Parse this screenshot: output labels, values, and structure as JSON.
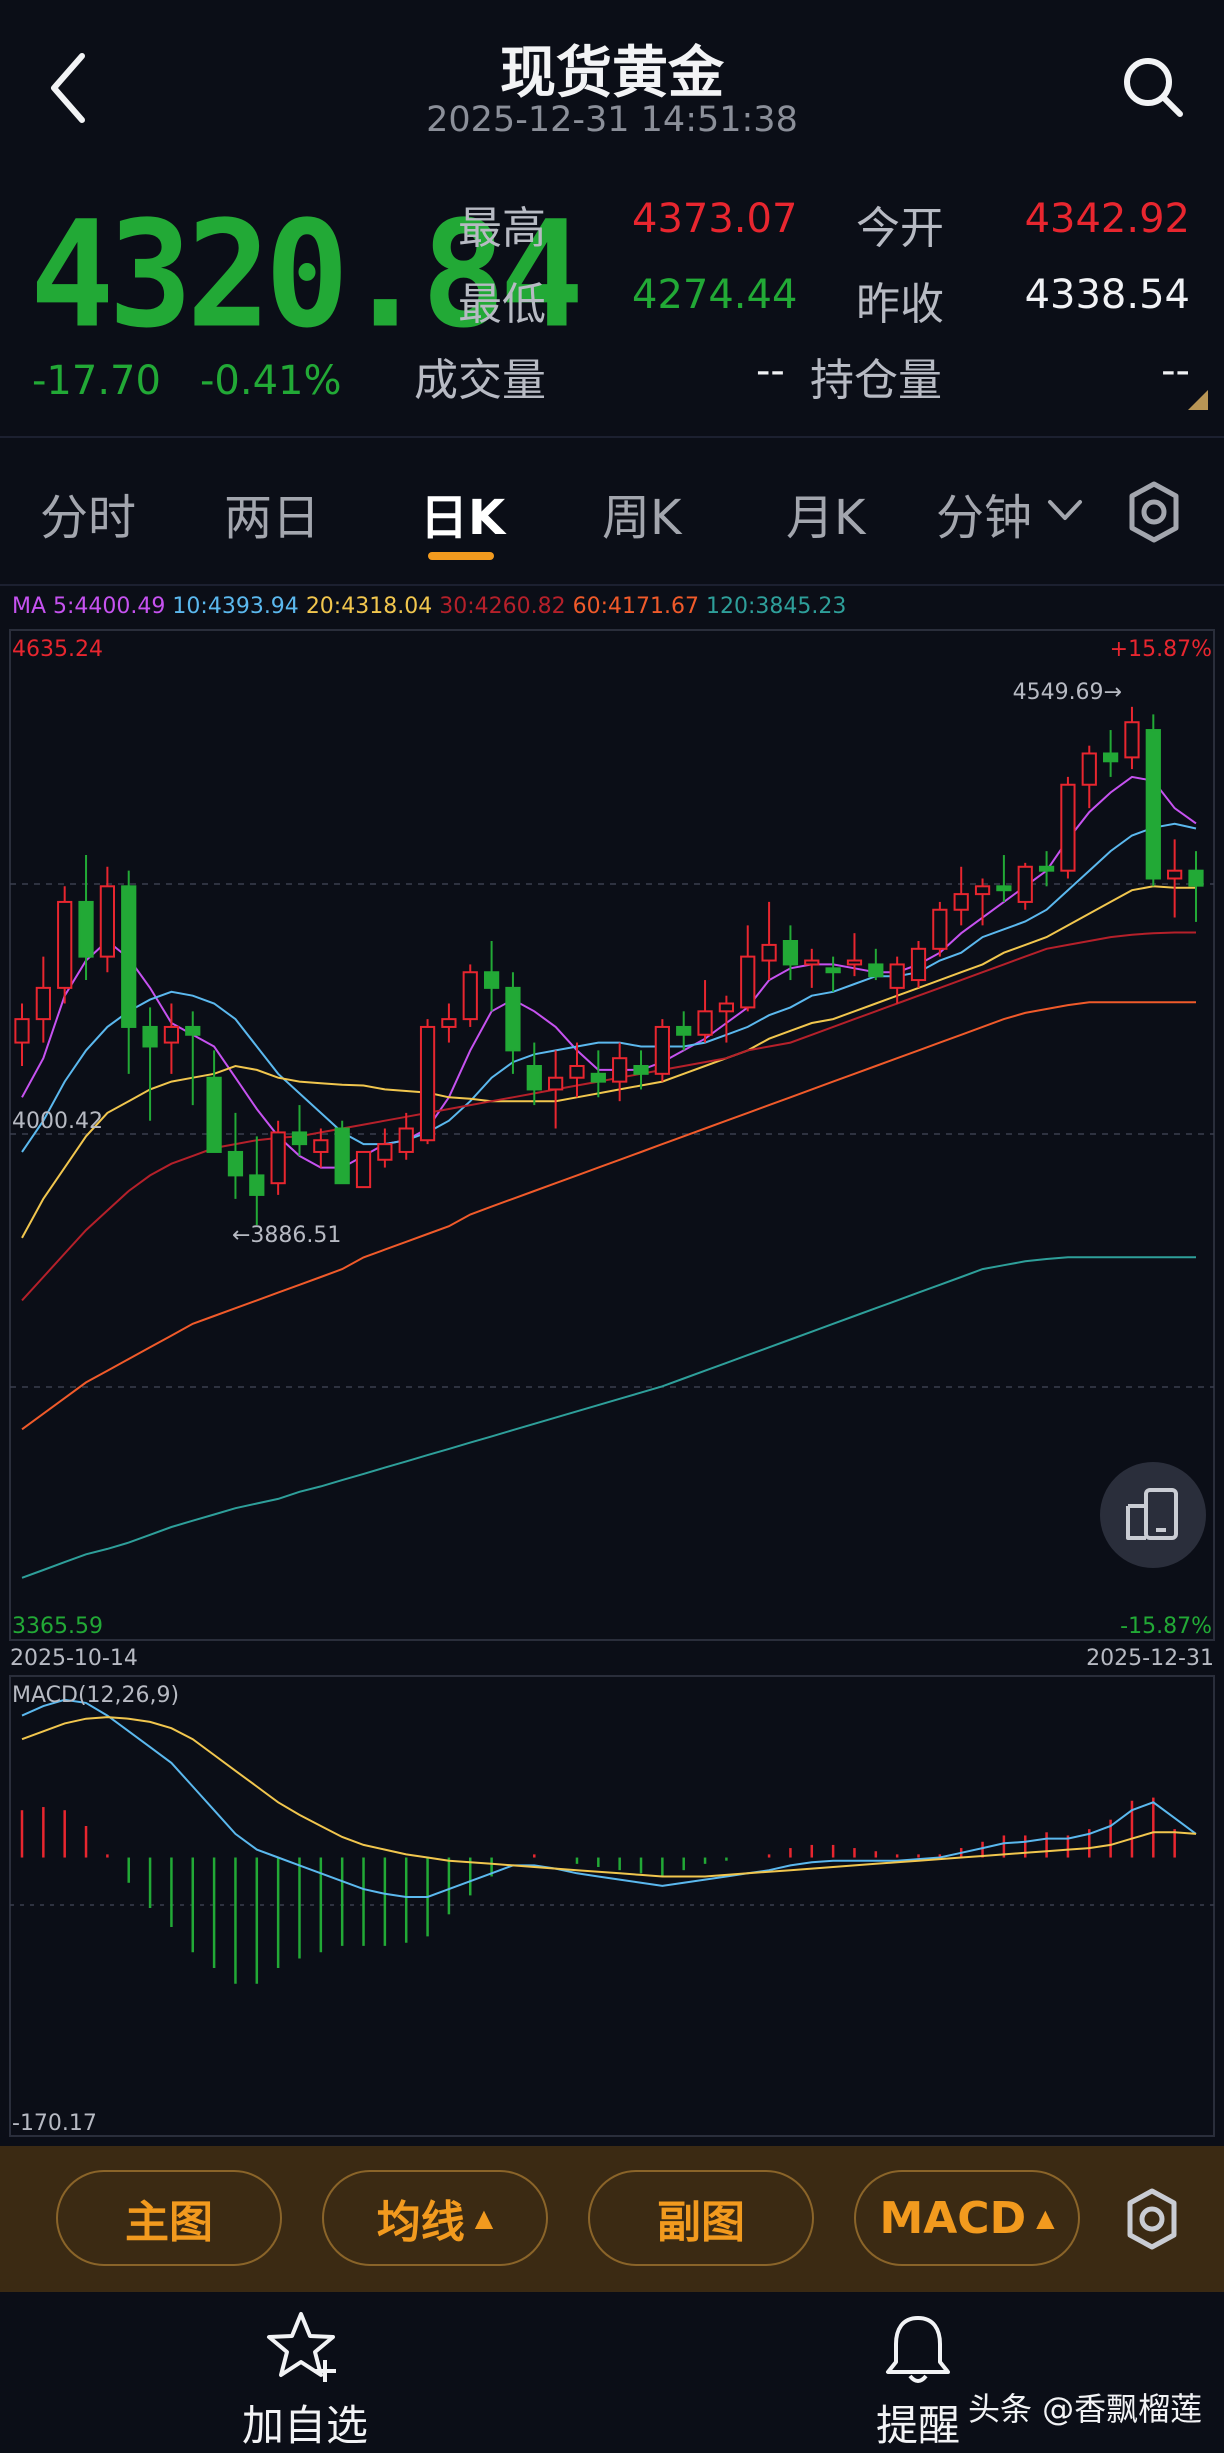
{
  "header": {
    "title": "现货黄金",
    "timestamp": "2025-12-31 14:51:38"
  },
  "quote": {
    "price": "4320.84",
    "change": "-17.70",
    "change_pct": "-0.41%",
    "high_label": "最高",
    "high": "4373.07",
    "open_label": "今开",
    "open": "4342.92",
    "low_label": "最低",
    "low": "4274.44",
    "prev_close_label": "昨收",
    "prev_close": "4338.54",
    "volume_label": "成交量",
    "volume": "--",
    "oi_label": "持仓量",
    "oi": "--"
  },
  "tabs": [
    "分时",
    "两日",
    "日K",
    "周K",
    "月K",
    "分钟"
  ],
  "active_tab": "日K",
  "ma_legend": [
    {
      "label": "MA 5:4400.49",
      "color": "#c652f0"
    },
    {
      "label": "10:4393.94",
      "color": "#5bb8ee"
    },
    {
      "label": "20:4318.04",
      "color": "#f1c64e"
    },
    {
      "label": "30:4260.82",
      "color": "#b5202a"
    },
    {
      "label": "60:4171.67",
      "color": "#f05a2a"
    },
    {
      "label": "120:3845.23",
      "color": "#2e9f9a"
    }
  ],
  "colors": {
    "up": "#e8262f",
    "down": "#22a936",
    "accent": "#f29a1e"
  },
  "chart_data": [
    {
      "type": "candlestick",
      "ylim": [
        3365.59,
        4635.24
      ],
      "y_top_label": "4635.24",
      "y_bottom_label": "3365.59",
      "y_mid_label": "4000.42",
      "pct_top_label": "+15.87%",
      "pct_bottom_label": "-15.87%",
      "x_start_label": "2025-10-14",
      "x_end_label": "2025-12-31",
      "high_marker": "4549.69→",
      "low_marker": "←3886.51",
      "candles": [
        {
          "o": 4120,
          "h": 4170,
          "l": 4090,
          "c": 4150
        },
        {
          "o": 4150,
          "h": 4230,
          "l": 4120,
          "c": 4190
        },
        {
          "o": 4190,
          "h": 4320,
          "l": 4170,
          "c": 4300
        },
        {
          "o": 4300,
          "h": 4360,
          "l": 4200,
          "c": 4230
        },
        {
          "o": 4230,
          "h": 4345,
          "l": 4210,
          "c": 4320
        },
        {
          "o": 4320,
          "h": 4340,
          "l": 4080,
          "c": 4140
        },
        {
          "o": 4140,
          "h": 4165,
          "l": 4020,
          "c": 4115
        },
        {
          "o": 4120,
          "h": 4170,
          "l": 4080,
          "c": 4140
        },
        {
          "o": 4140,
          "h": 4160,
          "l": 4040,
          "c": 4130
        },
        {
          "o": 4075,
          "h": 4110,
          "l": 3980,
          "c": 3980
        },
        {
          "o": 3980,
          "h": 4030,
          "l": 3920,
          "c": 3950
        },
        {
          "o": 3950,
          "h": 4000,
          "l": 3886.51,
          "c": 3925
        },
        {
          "o": 3940,
          "h": 4020,
          "l": 3925,
          "c": 4005
        },
        {
          "o": 4005,
          "h": 4040,
          "l": 3975,
          "c": 3990
        },
        {
          "o": 3980,
          "h": 4010,
          "l": 3960,
          "c": 3995
        },
        {
          "o": 4010,
          "h": 4020,
          "l": 3940,
          "c": 3940
        },
        {
          "o": 3935,
          "h": 3980,
          "l": 3935,
          "c": 3980
        },
        {
          "o": 3970,
          "h": 4010,
          "l": 3960,
          "c": 3990
        },
        {
          "o": 3980,
          "h": 4030,
          "l": 3970,
          "c": 4010
        },
        {
          "o": 3995,
          "h": 4150,
          "l": 3990,
          "c": 4140
        },
        {
          "o": 4140,
          "h": 4170,
          "l": 4120,
          "c": 4150
        },
        {
          "o": 4150,
          "h": 4220,
          "l": 4140,
          "c": 4210
        },
        {
          "o": 4210,
          "h": 4250,
          "l": 4160,
          "c": 4190
        },
        {
          "o": 4190,
          "h": 4210,
          "l": 4080,
          "c": 4110
        },
        {
          "o": 4090,
          "h": 4120,
          "l": 4040,
          "c": 4060
        },
        {
          "o": 4060,
          "h": 4110,
          "l": 4010,
          "c": 4075
        },
        {
          "o": 4075,
          "h": 4120,
          "l": 4050,
          "c": 4090
        },
        {
          "o": 4080,
          "h": 4110,
          "l": 4050,
          "c": 4070
        },
        {
          "o": 4070,
          "h": 4120,
          "l": 4045,
          "c": 4100
        },
        {
          "o": 4090,
          "h": 4110,
          "l": 4060,
          "c": 4080
        },
        {
          "o": 4080,
          "h": 4150,
          "l": 4070,
          "c": 4140
        },
        {
          "o": 4140,
          "h": 4160,
          "l": 4110,
          "c": 4130
        },
        {
          "o": 4130,
          "h": 4200,
          "l": 4120,
          "c": 4160
        },
        {
          "o": 4160,
          "h": 4180,
          "l": 4120,
          "c": 4170
        },
        {
          "o": 4165,
          "h": 4270,
          "l": 4160,
          "c": 4230
        },
        {
          "o": 4225,
          "h": 4300,
          "l": 4200,
          "c": 4245
        },
        {
          "o": 4250,
          "h": 4270,
          "l": 4200,
          "c": 4220
        },
        {
          "o": 4220,
          "h": 4240,
          "l": 4190,
          "c": 4225
        },
        {
          "o": 4215,
          "h": 4230,
          "l": 4185,
          "c": 4210
        },
        {
          "o": 4220,
          "h": 4260,
          "l": 4205,
          "c": 4225
        },
        {
          "o": 4220,
          "h": 4240,
          "l": 4200,
          "c": 4205
        },
        {
          "o": 4190,
          "h": 4230,
          "l": 4170,
          "c": 4220
        },
        {
          "o": 4200,
          "h": 4250,
          "l": 4190,
          "c": 4240
        },
        {
          "o": 4240,
          "h": 4300,
          "l": 4230,
          "c": 4290
        },
        {
          "o": 4290,
          "h": 4345,
          "l": 4270,
          "c": 4310
        },
        {
          "o": 4310,
          "h": 4330,
          "l": 4270,
          "c": 4320
        },
        {
          "o": 4320,
          "h": 4360,
          "l": 4300,
          "c": 4315
        },
        {
          "o": 4300,
          "h": 4350,
          "l": 4290,
          "c": 4345
        },
        {
          "o": 4345,
          "h": 4365,
          "l": 4320,
          "c": 4340
        },
        {
          "o": 4340,
          "h": 4460,
          "l": 4330,
          "c": 4450
        },
        {
          "o": 4450,
          "h": 4500,
          "l": 4420,
          "c": 4490
        },
        {
          "o": 4490,
          "h": 4520,
          "l": 4460,
          "c": 4480
        },
        {
          "o": 4485,
          "h": 4549.69,
          "l": 4470,
          "c": 4530
        },
        {
          "o": 4520,
          "h": 4540,
          "l": 4320,
          "c": 4330
        },
        {
          "o": 4330,
          "h": 4380,
          "l": 4280,
          "c": 4340
        },
        {
          "o": 4340,
          "h": 4365,
          "l": 4274.44,
          "c": 4320.84
        }
      ],
      "ma": {
        "ma5": [
          4050,
          4100,
          4180,
          4225,
          4250,
          4228,
          4190,
          4145,
          4130,
          4115,
          4075,
          4035,
          4000,
          3975,
          3960,
          3960,
          3975,
          3990,
          3995,
          4010,
          4050,
          4110,
          4160,
          4175,
          4160,
          4140,
          4110,
          4085,
          4085,
          4085,
          4095,
          4110,
          4125,
          4145,
          4165,
          4200,
          4215,
          4220,
          4220,
          4215,
          4210,
          4210,
          4220,
          4235,
          4260,
          4280,
          4300,
          4320,
          4340,
          4380,
          4415,
          4440,
          4460,
          4455,
          4420,
          4400.49
        ],
        "ma10": [
          3980,
          4020,
          4070,
          4110,
          4140,
          4160,
          4175,
          4185,
          4180,
          4170,
          4150,
          4115,
          4080,
          4055,
          4030,
          4005,
          3990,
          3990,
          3995,
          4005,
          4020,
          4045,
          4075,
          4095,
          4105,
          4110,
          4115,
          4120,
          4120,
          4115,
          4115,
          4115,
          4120,
          4130,
          4140,
          4155,
          4165,
          4180,
          4185,
          4195,
          4205,
          4205,
          4210,
          4225,
          4235,
          4255,
          4265,
          4275,
          4290,
          4315,
          4340,
          4365,
          4385,
          4395,
          4400,
          4393.94
        ],
        "ma20": [
          3870,
          3920,
          3960,
          4000,
          4030,
          4045,
          4060,
          4070,
          4075,
          4080,
          4090,
          4085,
          4075,
          4070,
          4068,
          4066,
          4065,
          4060,
          4058,
          4056,
          4050,
          4048,
          4045,
          4045,
          4045,
          4045,
          4050,
          4055,
          4060,
          4065,
          4070,
          4080,
          4090,
          4100,
          4110,
          4125,
          4135,
          4145,
          4150,
          4160,
          4170,
          4180,
          4190,
          4200,
          4210,
          4220,
          4235,
          4245,
          4255,
          4270,
          4285,
          4300,
          4315,
          4320,
          4318.04,
          4318.04
        ],
        "ma30": [
          3790,
          3820,
          3850,
          3880,
          3905,
          3930,
          3950,
          3965,
          3975,
          3985,
          3990,
          3995,
          3998,
          4000,
          4005,
          4010,
          4015,
          4020,
          4025,
          4030,
          4035,
          4040,
          4045,
          4050,
          4055,
          4060,
          4065,
          4070,
          4075,
          4080,
          4085,
          4090,
          4095,
          4100,
          4110,
          4115,
          4120,
          4130,
          4140,
          4150,
          4160,
          4170,
          4180,
          4190,
          4200,
          4210,
          4220,
          4230,
          4240,
          4245,
          4250,
          4255,
          4258,
          4260,
          4260.82,
          4260.82
        ],
        "ma60": [
          3625,
          3645,
          3665,
          3685,
          3700,
          3715,
          3730,
          3745,
          3760,
          3770,
          3780,
          3790,
          3800,
          3810,
          3820,
          3830,
          3845,
          3855,
          3865,
          3875,
          3885,
          3900,
          3910,
          3920,
          3930,
          3940,
          3950,
          3960,
          3970,
          3980,
          3990,
          4000,
          4010,
          4020,
          4030,
          4040,
          4050,
          4060,
          4070,
          4080,
          4090,
          4100,
          4110,
          4120,
          4130,
          4140,
          4150,
          4158,
          4163,
          4168,
          4171.67,
          4171.67,
          4171.67,
          4171.67,
          4171.67,
          4171.67
        ],
        "ma120": [
          3435,
          3445,
          3455,
          3465,
          3472,
          3480,
          3490,
          3500,
          3508,
          3516,
          3524,
          3530,
          3536,
          3545,
          3552,
          3560,
          3568,
          3576,
          3584,
          3592,
          3600,
          3608,
          3616,
          3624,
          3632,
          3640,
          3648,
          3656,
          3664,
          3672,
          3680,
          3690,
          3700,
          3710,
          3720,
          3730,
          3740,
          3750,
          3760,
          3770,
          3780,
          3790,
          3800,
          3810,
          3820,
          3830,
          3835,
          3840,
          3843,
          3845.23,
          3845.23,
          3845.23,
          3845.23,
          3845.23,
          3845.23,
          3845.23
        ]
      }
    },
    {
      "type": "macd",
      "label": "MACD(12,26,9)",
      "ylim": [
        -170.17,
        110
      ],
      "y_bottom_label": "-170.17",
      "dif": [
        90,
        96,
        100,
        98,
        90,
        80,
        70,
        60,
        45,
        30,
        15,
        5,
        0,
        -5,
        -10,
        -15,
        -20,
        -23,
        -25,
        -25,
        -20,
        -15,
        -10,
        -5,
        -5,
        -7,
        -10,
        -12,
        -14,
        -16,
        -18,
        -16,
        -14,
        -12,
        -10,
        -8,
        -5,
        -3,
        -2,
        -2,
        -2,
        -2,
        -1,
        0,
        3,
        6,
        9,
        10,
        12,
        12,
        15,
        20,
        30,
        35,
        25,
        15
      ],
      "dea": [
        75,
        80,
        85,
        88,
        89,
        88,
        86,
        82,
        75,
        65,
        55,
        45,
        35,
        27,
        20,
        13,
        8,
        5,
        2,
        0,
        -2,
        -3,
        -4,
        -5,
        -6,
        -7,
        -8,
        -9,
        -10,
        -11,
        -12,
        -12,
        -12,
        -11,
        -10,
        -9,
        -8,
        -7,
        -6,
        -5,
        -4,
        -3,
        -2,
        -1,
        0,
        1,
        2,
        3,
        4,
        5,
        6,
        8,
        12,
        16,
        16,
        15
      ],
      "hist": [
        30,
        32,
        30,
        20,
        2,
        -16,
        -32,
        -44,
        -60,
        -70,
        -80,
        -80,
        -70,
        -64,
        -60,
        -56,
        -56,
        -56,
        -54,
        -50,
        -36,
        -24,
        -12,
        0,
        2,
        0,
        -4,
        -6,
        -8,
        -10,
        -12,
        -8,
        -4,
        -2,
        0,
        2,
        6,
        8,
        8,
        6,
        4,
        2,
        2,
        2,
        6,
        10,
        14,
        14,
        16,
        14,
        18,
        24,
        36,
        38,
        18,
        0
      ]
    }
  ],
  "toolbar": {
    "main_chart": "主图",
    "ma": "均线",
    "sub_chart": "副图",
    "macd": "MACD"
  },
  "nav": {
    "add_watch": "加自选",
    "alert": "提醒"
  },
  "watermark": "头条 @香飘榴莲"
}
